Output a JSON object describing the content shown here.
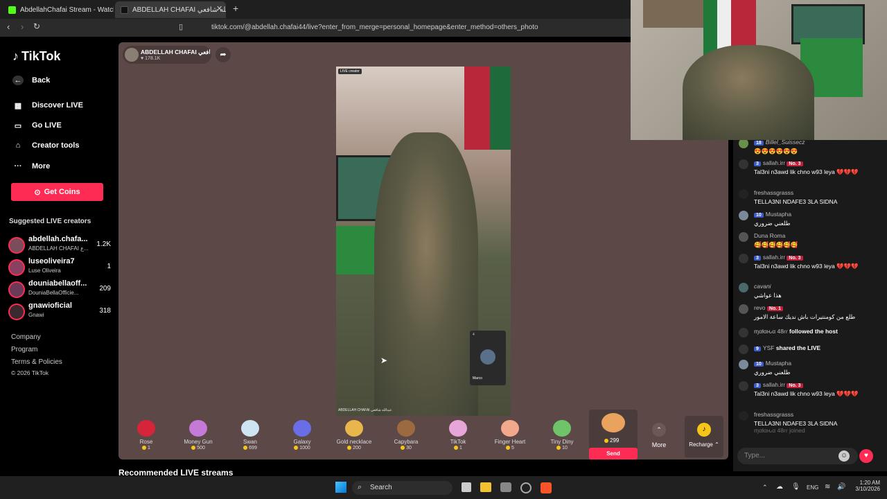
{
  "browser": {
    "tabs": [
      {
        "label": "AbdellahChafai Stream - Watch Live o",
        "active": false
      },
      {
        "label": "ABDELLAH CHAFAI عبدالله شافعي",
        "active": true
      }
    ],
    "url": "tiktok.com/@abdellah.chafai44/live?enter_from_merge=personal_homepage&enter_method=others_photo"
  },
  "sidebar": {
    "logo": "TikTok",
    "back": "Back",
    "nav": [
      {
        "label": "Discover LIVE",
        "icon": "calendar-icon"
      },
      {
        "label": "Go LIVE",
        "icon": "video-camera-icon"
      },
      {
        "label": "Creator tools",
        "icon": "home-icon"
      },
      {
        "label": "More",
        "icon": "more-dots-icon"
      }
    ],
    "get_coins": "Get Coins",
    "suggested_title": "Suggested LIVE creators",
    "suggested": [
      {
        "name": "abdellah.chafa...",
        "sub": "ABDELLAH CHAFAI ع...",
        "count": "1.2K"
      },
      {
        "name": "luseoliveira7",
        "sub": "Luse Oliveira",
        "count": "1"
      },
      {
        "name": "douniabellaoff...",
        "sub": "DouniaBellaOfficie...",
        "count": "209"
      },
      {
        "name": "gnawioficial",
        "sub": "Gnawi",
        "count": "318"
      }
    ],
    "footer": [
      "Company",
      "Program",
      "Terms & Policies",
      "© 2026 TikTok"
    ]
  },
  "stream": {
    "host_name": "ABDELLAH CHAFAI عبدالله شافعي",
    "likes": "178.1K",
    "video_label": "LIVE creator",
    "watermark": "ABDELLAH CHAFAI عبدالله شافعي",
    "pip_name": "Marco",
    "pip_count": "4"
  },
  "gifts": [
    {
      "name": "Rose",
      "price": "1",
      "color": "#d6243b"
    },
    {
      "name": "Money Gun",
      "price": "500",
      "color": "#c47ad6"
    },
    {
      "name": "Swan",
      "price": "699",
      "color": "#cfe4f2"
    },
    {
      "name": "Galaxy",
      "price": "1000",
      "color": "#6a6ee6"
    },
    {
      "name": "Gold necklace",
      "price": "200",
      "color": "#e8b64a"
    },
    {
      "name": "Capybara",
      "price": "30",
      "color": "#9b6b3f"
    },
    {
      "name": "TikTok",
      "price": "1",
      "color": "#e7a6d9"
    },
    {
      "name": "Finger Heart",
      "price": "5",
      "color": "#f2a88b"
    },
    {
      "name": "Tiny Diny",
      "price": "10",
      "color": "#6fc46a"
    }
  ],
  "featured_gift": {
    "price": "299",
    "send": "Send"
  },
  "more": "More",
  "recharge": "Recharge",
  "recommended": "Recommended LIVE streams",
  "chat": [
    {
      "user": "Billel_Suissecz",
      "badge": "18",
      "rank": "",
      "text": "😍😍😍😍😍😍"
    },
    {
      "user": "sallah.irr",
      "badge": "3",
      "rank": "No. 3",
      "text": "Tal3ni n3awd lik chno w93 leya 💔💔💔"
    },
    {
      "user": "freshassgrasss",
      "badge": "",
      "rank": "",
      "text": "TELLA3NI NDAFE3 3LA SIDNA"
    },
    {
      "user": "Mustapha",
      "badge": "10",
      "rank": "",
      "text": "طلعني ضروري"
    },
    {
      "user": "Duna Roma",
      "badge": "",
      "rank": "",
      "text": "🥰🥰🥰🥰🥰🥰"
    },
    {
      "user": "sallah.irr",
      "badge": "3",
      "rank": "No. 3",
      "text": "Tal3ni n3awd lik chno w93 leya 💔💔💔"
    },
    {
      "user": "cavani",
      "badge": "",
      "rank": "",
      "text": "هذا عواشي"
    },
    {
      "user": "revo",
      "badge": "",
      "rank": "No. 1",
      "text": "طلع من كومنتيرات باش نديك ساعة الامور"
    },
    {
      "user": "ɱαƚαԋα 48ɾɾ",
      "badge": "",
      "rank": "",
      "text": "followed the host"
    },
    {
      "user": "YSF",
      "badge": "9",
      "rank": "",
      "text": "shared the LIVE"
    },
    {
      "user": "Mustapha",
      "badge": "10",
      "rank": "",
      "text": "طلعني ضروري"
    },
    {
      "user": "sallah.irr",
      "badge": "3",
      "rank": "No. 3",
      "text": "Tal3ni n3awd lik chno w93 leya 💔💔💔"
    },
    {
      "user": "freshassgrasss",
      "badge": "",
      "rank": "",
      "text": "TELLA3NI NDAFE3 3LA SIDNA"
    },
    {
      "user": "ɱαƚαԋα 48ɾɾ",
      "badge": "",
      "rank": "",
      "text": "joined"
    }
  ],
  "chat_input_placeholder": "Type...",
  "taskbar": {
    "search": "Search",
    "lang": "ENG",
    "time": "1:20 AM",
    "date": "3/10/2026"
  }
}
